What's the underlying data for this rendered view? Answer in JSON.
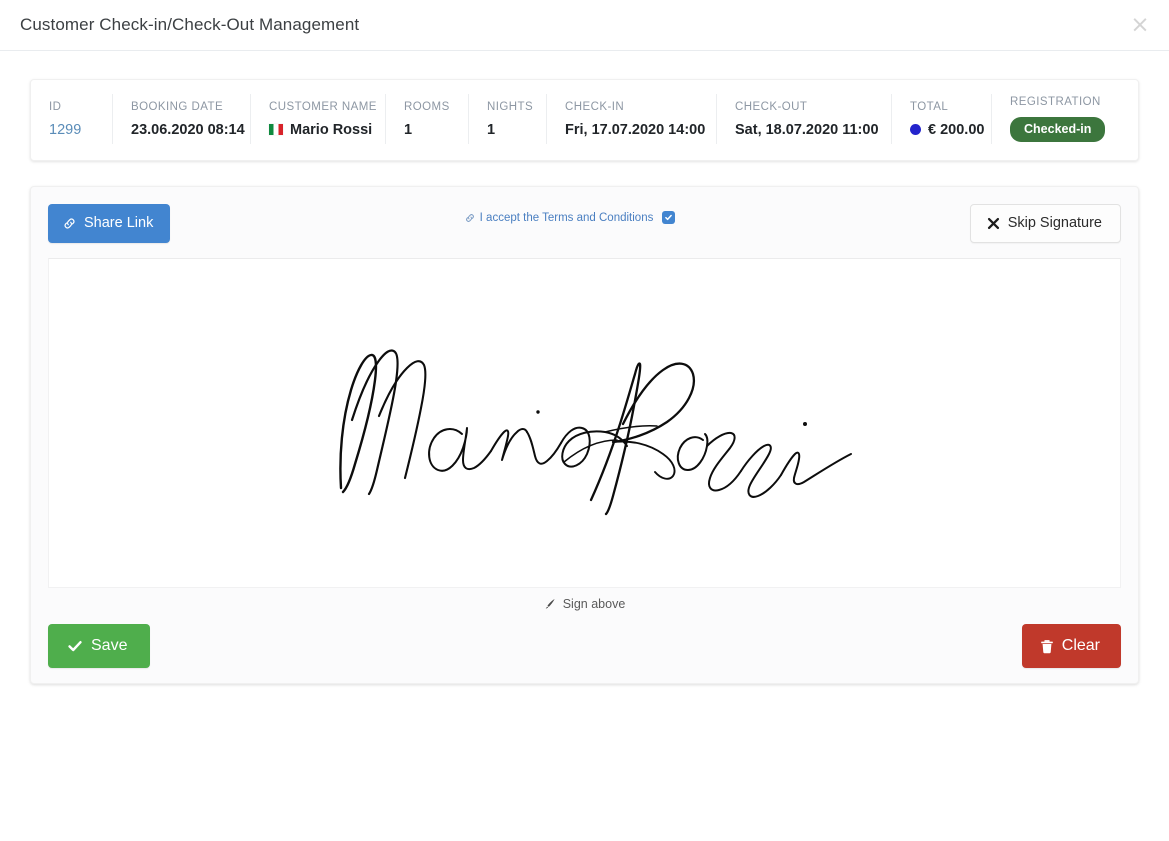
{
  "header": {
    "title": "Customer Check-in/Check-Out Management",
    "close_label": "×"
  },
  "summary": {
    "columns": [
      {
        "label": "ID",
        "value": "1299",
        "type": "link"
      },
      {
        "label": "BOOKING DATE",
        "value": "23.06.2020 08:14",
        "type": "text"
      },
      {
        "label": "CUSTOMER NAME",
        "value": "Mario Rossi",
        "type": "flag"
      },
      {
        "label": "ROOMS",
        "value": "1",
        "type": "text"
      },
      {
        "label": "NIGHTS",
        "value": "1",
        "type": "text"
      },
      {
        "label": "CHECK-IN",
        "value": "Fri, 17.07.2020 14:00",
        "type": "text"
      },
      {
        "label": "CHECK-OUT",
        "value": "Sat, 18.07.2020 11:00",
        "type": "text"
      },
      {
        "label": "TOTAL",
        "value": "€ 200.00",
        "type": "dot"
      },
      {
        "label": "REGISTRATION",
        "value": "Checked-in",
        "type": "badge"
      }
    ]
  },
  "signature": {
    "share_label": "Share Link",
    "terms_label": "I accept the Terms and Conditions",
    "terms_checked": true,
    "skip_label": "Skip Signature",
    "sign_hint": "Sign above",
    "save_label": "Save",
    "clear_label": "Clear",
    "signed_name": "Mario Rossi"
  },
  "colors": {
    "share_blue": "#4285d0",
    "save_green": "#4fae4c",
    "clear_red": "#c0392b",
    "badge_green": "#3c763d",
    "total_dot": "#2323cc",
    "id_link": "#5a8cb8"
  }
}
